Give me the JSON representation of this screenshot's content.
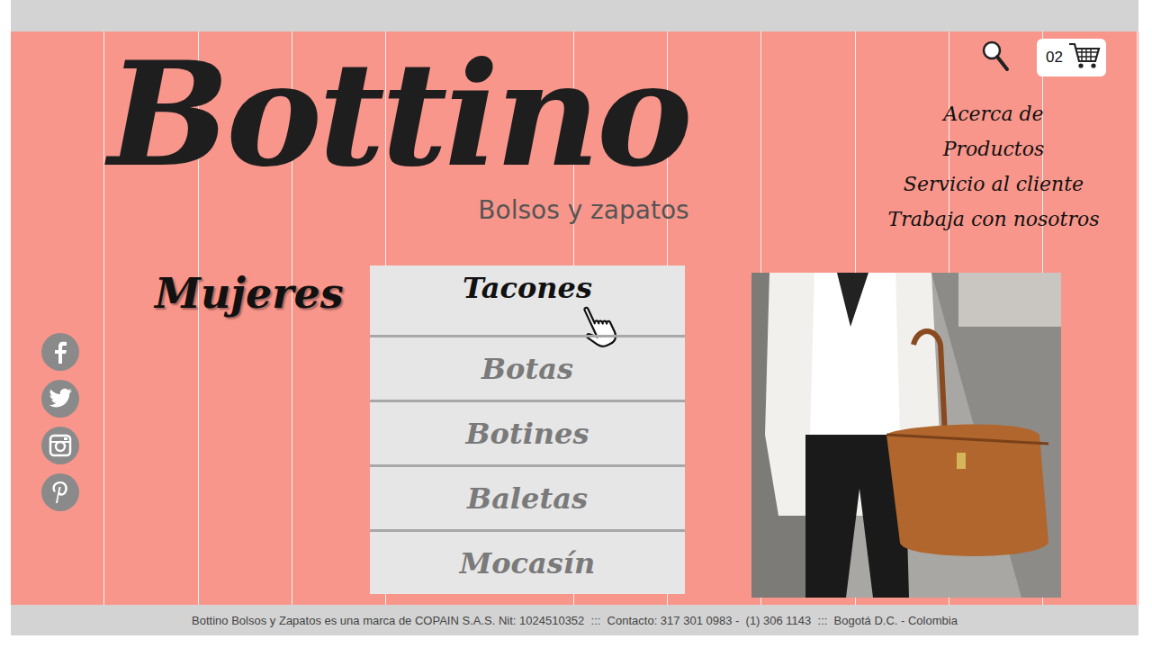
{
  "brand": {
    "name": "Bottino",
    "tagline": "Bolsos y zapatos"
  },
  "cart": {
    "count": "02"
  },
  "nav": [
    "Acerca de",
    "Productos",
    "Servicio al cliente",
    "Trabaja con nosotros"
  ],
  "section_title": "Mujeres",
  "categories": [
    {
      "label": "Tacones",
      "selected": true
    },
    {
      "label": "Botas",
      "selected": false
    },
    {
      "label": "Botines",
      "selected": false
    },
    {
      "label": "Baletas",
      "selected": false
    },
    {
      "label": "Mocasín",
      "selected": false
    }
  ],
  "footer": "Bottino Bolsos y Zapatos es una marca de COPAIN S.A.S. Nit: 1024510352  :::  Contacto: 317 301 0983 -  (1) 306 1143  :::  Bogotá D.C. - Colombia"
}
